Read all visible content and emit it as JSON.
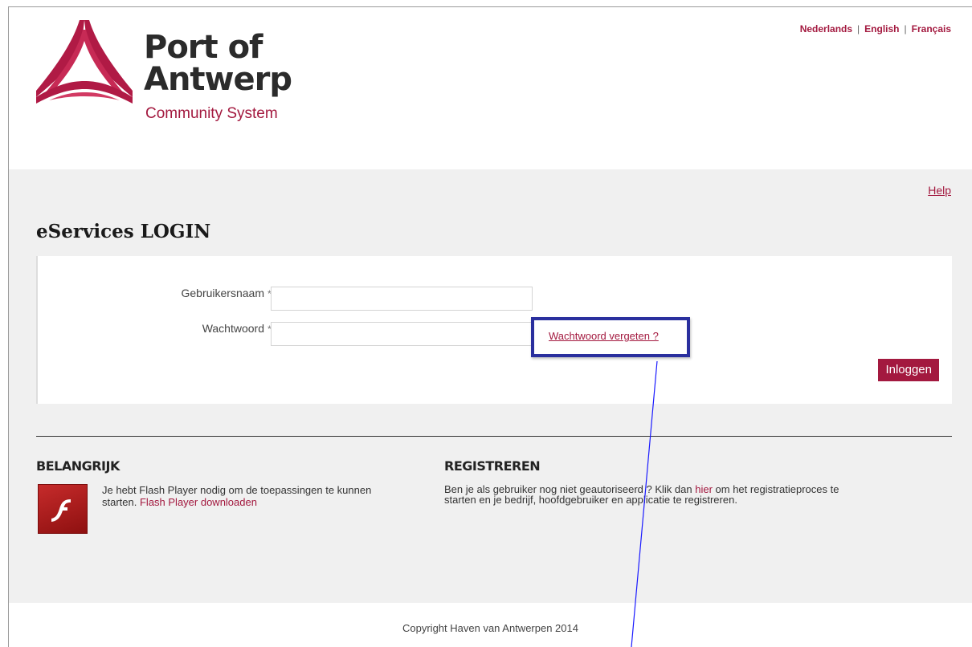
{
  "header": {
    "logo_line1": "Port of",
    "logo_line2": "Antwerp",
    "logo_sub": "Community System",
    "languages": [
      {
        "label": "Nederlands"
      },
      {
        "label": "English"
      },
      {
        "label": "Français"
      }
    ],
    "lang_separator": "|"
  },
  "main": {
    "help_label": "Help",
    "title": "eServices LOGIN",
    "login": {
      "username_label": "Gebruikersnaam",
      "password_label": "Wachtwoord",
      "required_marker": "*",
      "username_value": "",
      "password_value": "",
      "forgot_label": "Wachtwoord vergeten ?",
      "submit_label": "Inloggen"
    },
    "important": {
      "title": "BELANGRIJK",
      "text": "Je hebt Flash Player nodig om de toepassingen te kunnen starten.",
      "link_label": "Flash Player downloaden"
    },
    "register": {
      "title": "REGISTREREN",
      "text_before": "Ben je als gebruiker nog niet geautoriseerd ? Klik dan",
      "link_label": "hier",
      "text_after": "om het registratieproces te starten en je bedrijf, hoofdgebruiker en applicatie te registreren."
    }
  },
  "footer": {
    "copyright": "Copyright Haven van Antwerpen 2014"
  },
  "colors": {
    "brand": "#a3193f",
    "highlight": "#2a2f9e",
    "annotation_line": "#1a1aff",
    "panel_bg": "#f0f0f0"
  },
  "icons": {
    "logo": "port-of-antwerp-logo-icon",
    "flash": "flash-player-icon"
  }
}
